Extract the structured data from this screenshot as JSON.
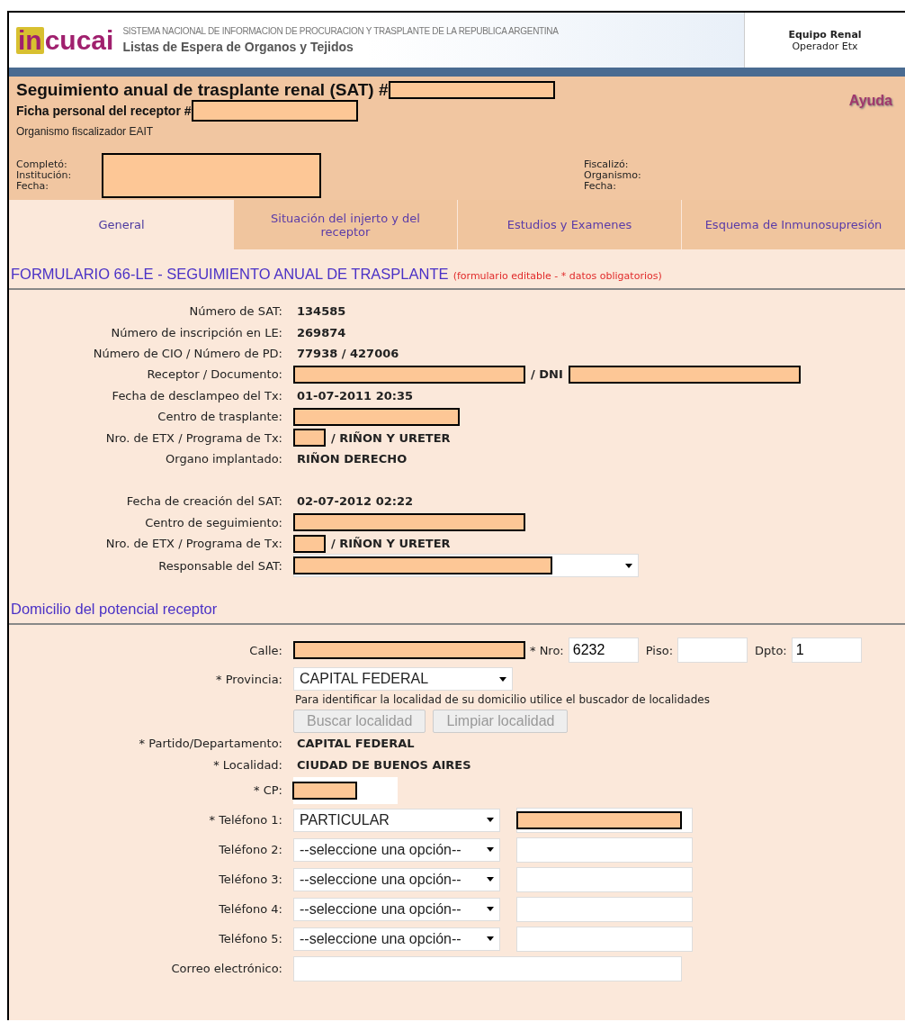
{
  "header": {
    "logo": [
      "in",
      "cucai"
    ],
    "system_name": "SISTEMA NACIONAL DE INFORMACION DE PROCURACION Y TRASPLANTE DE LA REPUBLICA ARGENTINA",
    "app_title": "Listas de Espera de Organos y Tejidos",
    "user_role": "Equipo Renal",
    "user_name": "Operador Etx"
  },
  "record": {
    "title": "Seguimiento anual de trasplante renal (SAT) #",
    "ficha": "Ficha personal del receptor #",
    "organismo": "Organismo fiscalizador EAIT",
    "help": "Ayuda"
  },
  "audit": {
    "left": [
      "Completó:",
      "Institución:",
      "Fecha:"
    ],
    "right": [
      "Fiscalizó:",
      "Organismo:",
      "Fecha:"
    ]
  },
  "tabs": [
    {
      "label": "General",
      "selected": true
    },
    {
      "label": "Situación del injerto y del receptor",
      "selected": false
    },
    {
      "label": "Estudios y Examenes",
      "selected": false
    },
    {
      "label": "Esquema de Inmunosupresión",
      "selected": false
    }
  ],
  "form_title": "FORMULARIO 66-LE - SEGUIMIENTO ANUAL DE TRASPLANTE",
  "form_note": "(formulario editable - * datos obligatorios)",
  "info_groups": [
    [
      {
        "label": "Número de SAT:",
        "kind": "text",
        "value": "134585"
      },
      {
        "label": "Número de inscripción en LE:",
        "kind": "text",
        "value": "269874"
      },
      {
        "label": "Número de CIO / Número de PD:",
        "kind": "text",
        "value": "77938 / 427006"
      },
      {
        "label": "Receptor / Documento:",
        "kind": "pair",
        "value": "/ DNI"
      },
      {
        "label": "Fecha de desclampeo del Tx:",
        "kind": "text",
        "value": "01-07-2011 20:35"
      },
      {
        "label": "Centro de trasplante:",
        "kind": "redacted"
      },
      {
        "label": "Nro. de ETX / Programa de Tx:",
        "kind": "program",
        "value": "/ RIÑON Y URETER"
      },
      {
        "label": "Organo implantado:",
        "kind": "text",
        "value": "RIÑON DERECHO"
      }
    ],
    [
      {
        "label": "Fecha de creación del SAT:",
        "kind": "text",
        "value": "02-07-2012 02:22"
      },
      {
        "label": "Centro de seguimiento:",
        "kind": "redacted"
      },
      {
        "label": "Nro. de ETX / Programa de Tx:",
        "kind": "program",
        "value": "/ RIÑON Y URETER"
      },
      {
        "label": "Responsable del SAT:",
        "kind": "select"
      }
    ]
  ],
  "address": {
    "title": "Domicilio del potencial receptor",
    "calle": "Calle:",
    "nro_label": "* Nro:",
    "nro": "6232",
    "piso_label": "Piso:",
    "dpto_label": "Dpto:",
    "dpto": "1",
    "provincia_label": "* Provincia:",
    "provincia": "CAPITAL FEDERAL",
    "hint": "Para identificar la localidad de su domicilio utilice el buscador de localidades",
    "buttons": [
      {
        "label": "Buscar localidad",
        "disabled": true
      },
      {
        "label": "Limpiar localidad",
        "disabled": true
      }
    ],
    "partido_label": "* Partido/Departamento:",
    "partido": "CAPITAL FEDERAL",
    "localidad_label": "* Localidad:",
    "localidad": "CIUDAD DE BUENOS AIRES",
    "cp_label": "* CP:",
    "phones": [
      {
        "label": "* Teléfono 1:",
        "type": "PARTICULAR",
        "redacted": true
      },
      {
        "label": "Teléfono 2:",
        "type": "--seleccione una opción--",
        "redacted": false
      },
      {
        "label": "Teléfono 3:",
        "type": "--seleccione una opción--",
        "redacted": false
      },
      {
        "label": "Teléfono 4:",
        "type": "--seleccione una opción--",
        "redacted": false
      },
      {
        "label": "Teléfono 5:",
        "type": "--seleccione una opción--",
        "redacted": false
      }
    ],
    "email_label": "Correo electrónico:"
  }
}
